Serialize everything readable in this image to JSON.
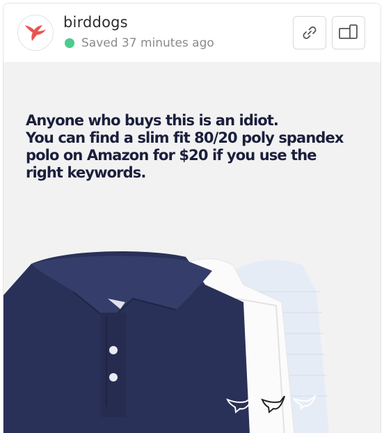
{
  "header": {
    "brand_name": "birddogs",
    "status_text": "Saved 37 minutes ago",
    "status_color": "#4ccb8b",
    "logo_icon": "hummingbird-logo-icon",
    "buttons": [
      {
        "icon": "link-icon"
      },
      {
        "icon": "device-preview-icon"
      }
    ]
  },
  "post": {
    "headline_lines": [
      "Anyone who buys this is an idiot.",
      "You can find a slim fit 80/20 poly spandex",
      "polo on Amazon for $20 if you use the",
      "right keywords."
    ],
    "headline_color": "#1b1f3c",
    "image": {
      "subject": "stacked polo shirts",
      "shirt_colors": [
        "#2a3158",
        "#ffffff",
        "#dfe6f3"
      ],
      "logo_icon": "bird-logo-icon"
    }
  }
}
